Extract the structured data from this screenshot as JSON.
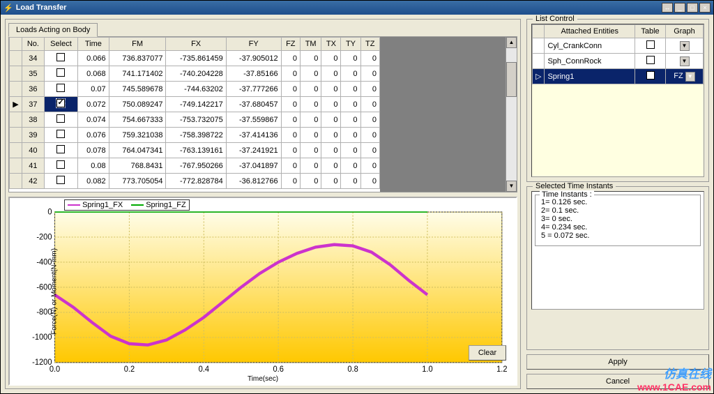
{
  "window": {
    "title": "Load Transfer"
  },
  "tabs": {
    "loadsActing": "Loads Acting on Body"
  },
  "table": {
    "headers": [
      "No.",
      "Select",
      "Time",
      "FM",
      "FX",
      "FY",
      "FZ",
      "TM",
      "TX",
      "TY",
      "TZ"
    ],
    "selectedRow": 3,
    "rows": [
      {
        "no": "34",
        "sel": false,
        "time": "0.066",
        "fm": "736.837077",
        "fx": "-735.861459",
        "fy": "-37.905012",
        "fz": "0",
        "tm": "0",
        "tx": "0",
        "ty": "0",
        "tz": "0"
      },
      {
        "no": "35",
        "sel": false,
        "time": "0.068",
        "fm": "741.171402",
        "fx": "-740.204228",
        "fy": "-37.85166",
        "fz": "0",
        "tm": "0",
        "tx": "0",
        "ty": "0",
        "tz": "0"
      },
      {
        "no": "36",
        "sel": false,
        "time": "0.07",
        "fm": "745.589678",
        "fx": "-744.63202",
        "fy": "-37.777266",
        "fz": "0",
        "tm": "0",
        "tx": "0",
        "ty": "0",
        "tz": "0"
      },
      {
        "no": "37",
        "sel": true,
        "time": "0.072",
        "fm": "750.089247",
        "fx": "-749.142217",
        "fy": "-37.680457",
        "fz": "0",
        "tm": "0",
        "tx": "0",
        "ty": "0",
        "tz": "0"
      },
      {
        "no": "38",
        "sel": false,
        "time": "0.074",
        "fm": "754.667333",
        "fx": "-753.732075",
        "fy": "-37.559867",
        "fz": "0",
        "tm": "0",
        "tx": "0",
        "ty": "0",
        "tz": "0"
      },
      {
        "no": "39",
        "sel": false,
        "time": "0.076",
        "fm": "759.321038",
        "fx": "-758.398722",
        "fy": "-37.414136",
        "fz": "0",
        "tm": "0",
        "tx": "0",
        "ty": "0",
        "tz": "0"
      },
      {
        "no": "40",
        "sel": false,
        "time": "0.078",
        "fm": "764.047341",
        "fx": "-763.139161",
        "fy": "-37.241921",
        "fz": "0",
        "tm": "0",
        "tx": "0",
        "ty": "0",
        "tz": "0"
      },
      {
        "no": "41",
        "sel": false,
        "time": "0.08",
        "fm": "768.8431",
        "fx": "-767.950266",
        "fy": "-37.041897",
        "fz": "0",
        "tm": "0",
        "tx": "0",
        "ty": "0",
        "tz": "0"
      },
      {
        "no": "42",
        "sel": false,
        "time": "0.082",
        "fm": "773.705054",
        "fx": "-772.828784",
        "fy": "-36.812766",
        "fz": "0",
        "tm": "0",
        "tx": "0",
        "ty": "0",
        "tz": "0"
      }
    ]
  },
  "listControl": {
    "title": "List Control",
    "headers": [
      "Attached Entities",
      "Table",
      "Graph"
    ],
    "rows": [
      {
        "name": "Cyl_CrankConn",
        "table": false,
        "graph": ""
      },
      {
        "name": "Sph_ConnRock",
        "table": false,
        "graph": ""
      },
      {
        "name": "Spring1",
        "table": true,
        "graph": "FZ",
        "selected": true
      }
    ]
  },
  "timeInstants": {
    "boxTitle": "Selected Time Instants",
    "innerTitle": "Time Instants :",
    "items": [
      "1= 0.126 sec.",
      "2= 0.1 sec.",
      "3= 0 sec.",
      "4= 0.234 sec.",
      "5 = 0.072 sec."
    ]
  },
  "buttons": {
    "clear": "Clear",
    "apply": "Apply",
    "cancel": "Cancel"
  },
  "chart": {
    "legend": [
      "Spring1_FX",
      "Spring1_FZ"
    ],
    "xlabel": "Time(sec)",
    "ylabel": "Force(N) or Moment(N-mm)",
    "yticks": [
      "0",
      "-200",
      "-400",
      "-600",
      "-800",
      "-1000",
      "-1200"
    ],
    "xticks": [
      "0.0",
      "0.2",
      "0.4",
      "0.6",
      "0.8",
      "1.0",
      "1.2"
    ]
  },
  "chart_data": {
    "type": "line",
    "title": "",
    "xlabel": "Time(sec)",
    "ylabel": "Force(N) or Moment(N-mm)",
    "xlim": [
      0.0,
      1.2
    ],
    "ylim": [
      -1200,
      0
    ],
    "x": [
      0.0,
      0.05,
      0.1,
      0.15,
      0.2,
      0.25,
      0.3,
      0.35,
      0.4,
      0.45,
      0.5,
      0.55,
      0.6,
      0.65,
      0.7,
      0.75,
      0.8,
      0.85,
      0.9,
      0.95,
      1.0
    ],
    "series": [
      {
        "name": "Spring1_FX",
        "color": "#cc33cc",
        "values": [
          -660,
          -760,
          -880,
          -990,
          -1050,
          -1060,
          -1020,
          -940,
          -840,
          -720,
          -600,
          -490,
          -400,
          -330,
          -280,
          -260,
          -270,
          -320,
          -420,
          -545,
          -660
        ]
      },
      {
        "name": "Spring1_FZ",
        "color": "#00aa00",
        "values": [
          0,
          0,
          0,
          0,
          0,
          0,
          0,
          0,
          0,
          0,
          0,
          0,
          0,
          0,
          0,
          0,
          0,
          0,
          0,
          0,
          0
        ]
      }
    ]
  },
  "watermark": {
    "cn": "仿真在线",
    "url": "www.1CAE.com"
  }
}
